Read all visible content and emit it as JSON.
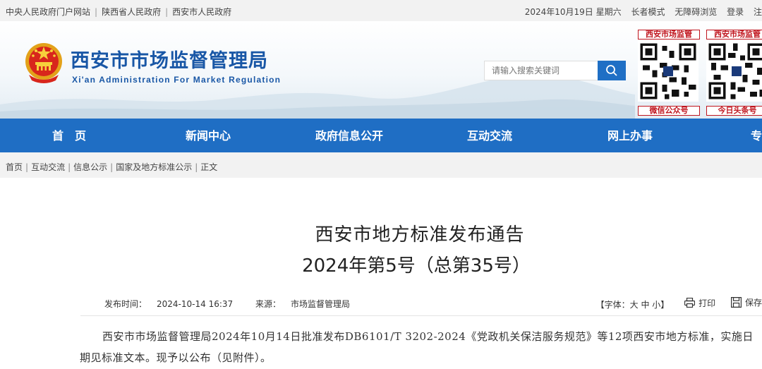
{
  "topbar": {
    "links": [
      "中央人民政府门户网站",
      "陕西省人民政府",
      "西安市人民政府"
    ],
    "date": "2024年10月19日 星期六",
    "senior_mode": "长者模式",
    "accessibility": "无障碍浏览",
    "login": "登录",
    "register": "注"
  },
  "header": {
    "title": "西安市市场监督管理局",
    "subtitle": "Xi'an Administration For Market Regulation",
    "search_placeholder": "请输入搜索关键词",
    "qr_wechat_label": "西安市场监管",
    "qr_wechat_caption": "微信公众号",
    "qr_toutiao_label": "西安市场监管",
    "qr_toutiao_caption": "今日头条号"
  },
  "nav": {
    "items": [
      "首　页",
      "新闻中心",
      "政府信息公开",
      "互动交流",
      "网上办事",
      "专"
    ]
  },
  "breadcrumb": {
    "items": [
      "首页",
      "互动交流",
      "信息公示",
      "国家及地方标准公示",
      "正文"
    ]
  },
  "article": {
    "title_line1": "西安市地方标准发布通告",
    "title_line2": "2024年第5号（总第35号）",
    "publish_time_label": "发布时间：",
    "publish_time": "2024-10-14 16:37",
    "source_label": "来源：",
    "source": "市场监督管理局",
    "font_label": "【字体：",
    "font_large": "大",
    "font_medium": "中",
    "font_small": "小",
    "font_close": "】",
    "print": "打印",
    "save": "保存",
    "body": "西安市市场监督管理局2024年10月14日批准发布DB6101/T 3202-2024《党政机关保洁服务规范》等12项西安市地方标准，实施日期见标准文本。现予以公布（见附件）。"
  },
  "colors": {
    "nav_bg": "#1f6ec4",
    "brand_blue": "#1957a6",
    "qr_red": "#c0151e"
  }
}
